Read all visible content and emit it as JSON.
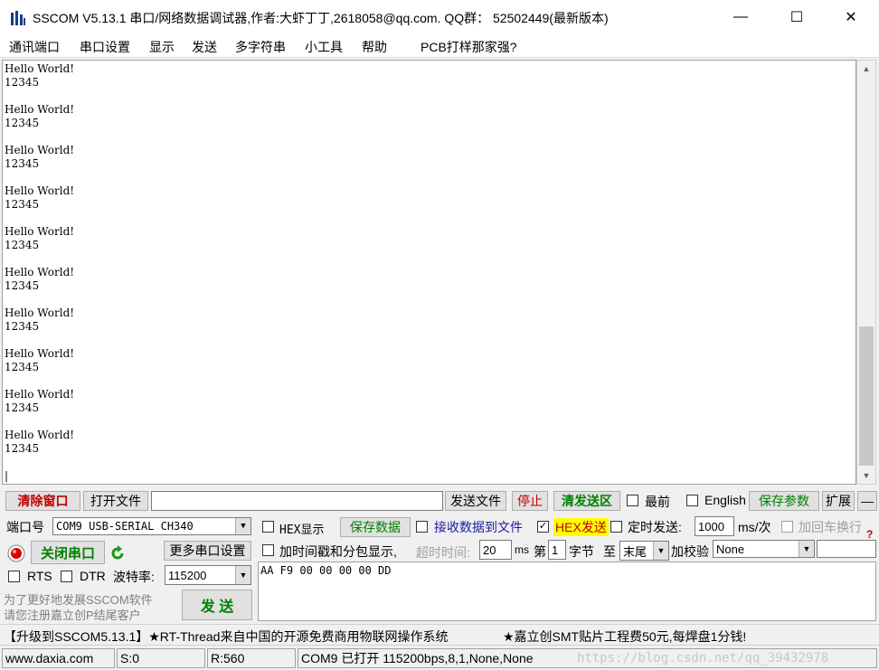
{
  "window": {
    "title": "SSCOM V5.13.1 串口/网络数据调试器,作者:大虾丁丁,2618058@qq.com. QQ群： 52502449(最新版本)",
    "minimize": "—",
    "maximize": "☐",
    "close": "✕"
  },
  "menu": [
    "通讯端口",
    "串口设置",
    "显示",
    "发送",
    "多字符串",
    "小工具",
    "帮助",
    "PCB打样那家强?"
  ],
  "receive": {
    "text": "Hello World!\n12345\n\nHello World!\n12345\n\nHello World!\n12345\n\nHello World!\n12345\n\nHello World!\n12345\n\nHello World!\n12345\n\nHello World!\n12345\n\nHello World!\n12345\n\nHello World!\n12345\n\nHello World!\n12345\n\n|"
  },
  "toolbar1": {
    "clear_window": "清除窗口",
    "open_file": "打开文件",
    "file_path": "",
    "send_file": "发送文件",
    "stop": "停止",
    "clear_send": "清发送区",
    "topmost": "最前",
    "english": "English",
    "save_params": "保存参数",
    "expand": "扩展",
    "collapse": "—"
  },
  "port": {
    "port_label": "端口号",
    "port_value": "COM9 USB-SERIAL CH340",
    "hex_display": "HEX显示",
    "save_data": "保存数据",
    "recv_to_file": "接收数据到文件",
    "hex_send": "HEX发送",
    "hex_send_checked": "✓",
    "timed_send": "定时发送:",
    "interval": "1000",
    "interval_unit": "ms/次",
    "add_crlf": "加回车换行"
  },
  "row2": {
    "close_port": "关闭串口",
    "more_settings": "更多串口设置",
    "timestamp": "加时间戳和分包显示,",
    "timeout_label": "超时时间:",
    "timeout_value": "20",
    "ms": "ms",
    "di": "第",
    "byte_index": "1",
    "byte_label": "字节",
    "to": "至",
    "end_value": "末尾",
    "checksum_label": "加校验",
    "checksum_value": "None",
    "question": "?"
  },
  "row3": {
    "rts": "RTS",
    "dtr": "DTR",
    "baud_label": "波特率:",
    "baud_value": "115200"
  },
  "send": {
    "text": "AA F9 00 00 00 00 DD",
    "button": "发  送"
  },
  "notice": {
    "line1": "为了更好地发展SSCOM软件",
    "line2": "请您注册嘉立创P结尾客户"
  },
  "promo": {
    "left": "【升级到SSCOM5.13.1】★RT-Thread来自中国的开源免费商用物联网操作系统",
    "right": "★嘉立创SMT贴片工程费50元,每焊盘1分钱!"
  },
  "status": {
    "website": "www.daxia.com",
    "sent": "S:0",
    "received": "R:560",
    "port_status": "COM9 已打开  115200bps,8,1,None,None",
    "watermark": "https://blog.csdn.net/qq_39432978"
  },
  "colors": {
    "clear_red": "#c00000",
    "green": "#008000",
    "hex_highlight": "#ffff00"
  }
}
